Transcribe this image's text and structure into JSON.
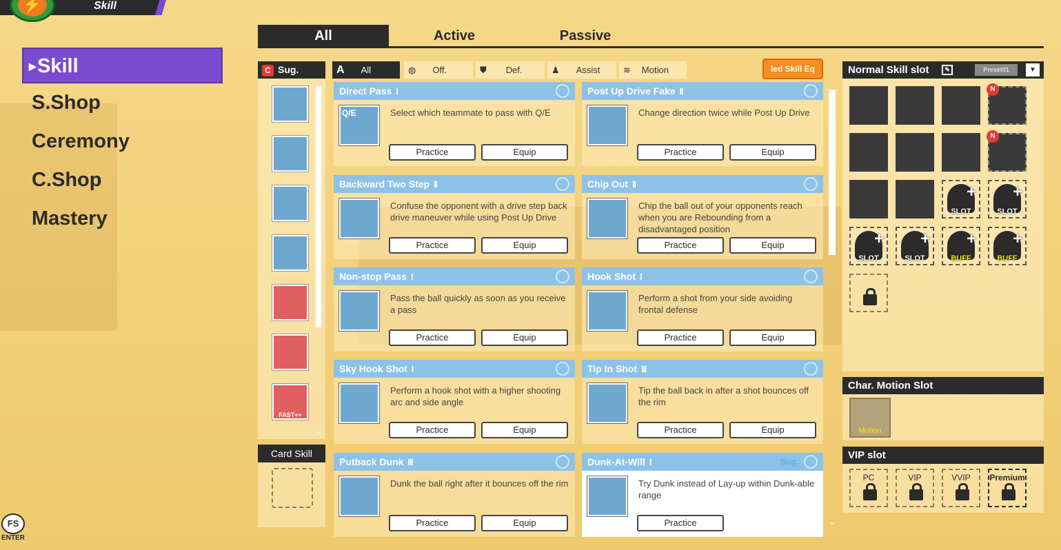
{
  "header": {
    "title": "Skill",
    "logo_icon": "lightning-basketball-logo"
  },
  "nav": {
    "items": [
      {
        "label": "Skill",
        "active": true
      },
      {
        "label": "S.Shop"
      },
      {
        "label": "Ceremony"
      },
      {
        "label": "C.Shop"
      },
      {
        "label": "Mastery"
      }
    ]
  },
  "tabs": [
    {
      "label": "All",
      "active": true
    },
    {
      "label": "Active"
    },
    {
      "label": "Passive"
    }
  ],
  "suggested": {
    "title": "Sug.",
    "badge": "C",
    "icons": [
      "pass-icon",
      "dribble-icon",
      "drive-icon",
      "layup-icon",
      "rebound-icon",
      "block-icon",
      "fast-icon"
    ],
    "fast_label": "FAST++"
  },
  "card_skill": {
    "title": "Card Skill"
  },
  "filters": {
    "all_letter": "A",
    "items": [
      "All",
      "Off.",
      "Def.",
      "Assist",
      "Motion"
    ],
    "equipped_button": "led Skill",
    "equipped_suffix": "Eq"
  },
  "skills": [
    {
      "name": "Direct Pass",
      "level": "Ⅰ",
      "desc": "Select which teammate to pass with Q/E",
      "img_label": "Q/E"
    },
    {
      "name": "Post Up Drive Fake",
      "level": "Ⅱ",
      "desc": "Change direction twice while Post Up Drive"
    },
    {
      "name": "Backward Two Step",
      "level": "Ⅱ",
      "desc": "Confuse the opponent with a drive step back drive maneuver while using Post Up Drive"
    },
    {
      "name": "Chip Out",
      "level": "Ⅱ",
      "desc": "Chip the ball out of your opponents reach when you are Rebounding from a disadvantaged position"
    },
    {
      "name": "Non-stop Pass",
      "level": "Ⅰ",
      "desc": "Pass the ball quickly as soon as you receive a pass"
    },
    {
      "name": "Hook Shot",
      "level": "Ⅰ",
      "desc": "Perform a shot from your side avoiding frontal defense"
    },
    {
      "name": "Sky Hook Shot",
      "level": "Ⅰ",
      "desc": "Perform a hook shot with a higher shooting arc and side angle"
    },
    {
      "name": "Tip In Shot",
      "level": "Ⅲ",
      "desc": "Tip the ball back in after a shot bounces off the rim"
    },
    {
      "name": "Putback Dunk",
      "level": "Ⅲ",
      "desc": "Dunk the ball right after it bounces off the rim"
    },
    {
      "name": "Dunk-At-Will",
      "level": "Ⅰ",
      "desc": "Try Dunk instead of Lay-up within Dunk-able range",
      "tag": "Sug."
    }
  ],
  "buttons": {
    "practice": "Practice",
    "equip": "Equip"
  },
  "normal_slot": {
    "title": "Normal Skill slot",
    "preset": "Preset01",
    "new_badge": "N",
    "slot_label": "SLOT",
    "buff_label": "BUFF"
  },
  "motion_slot": {
    "title": "Char. Motion Slot",
    "label": "Motion"
  },
  "vip_slot": {
    "title": "VIP slot",
    "items": [
      "PC",
      "VIP",
      "VVIP",
      "Premium"
    ]
  },
  "chat": {
    "label": "FS",
    "enter": "ENTER"
  }
}
